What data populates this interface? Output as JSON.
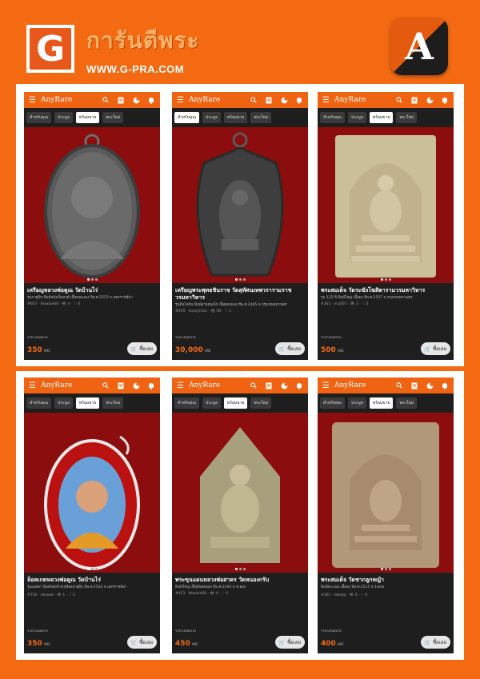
{
  "brand": {
    "logo_letter": "G",
    "title": "การันตีพระ",
    "url": "WWW.G-PRA.COM",
    "app_logo_letter": "A"
  },
  "app": {
    "name": "AnyRare",
    "tabs": [
      "สำหรับคุณ",
      "ประมูล",
      "พร้อมขาย",
      "พระใหม่"
    ],
    "price_label": "ราคาเสนอขาย",
    "price_unit": "ARC",
    "buy_label": "ซื้อเลย",
    "icons": [
      "menu-icon",
      "search-icon",
      "receipt-icon",
      "pie-chart-icon",
      "bell-icon"
    ],
    "accent": "#f06312"
  },
  "cards": [
    {
      "active_tab": 2,
      "title": "เหรียญหลวงพ่อคูณ วัดบ้านไร่",
      "sub": "รุ่นกาฐูลิข พิมพ์หลังเต็มองค์ เนื้อทองแดง ปีพ.ศ.2553 จ.นครราชสีมา",
      "id": "#667",
      "seller": "Newbie08",
      "views": "4",
      "likes": "0",
      "price": "350"
    },
    {
      "active_tab": 0,
      "title": "เหรียญพระพุทธชินราช วัดสุทัศนเทพวรารามราชวรมหาวิหาร",
      "sub": "รุ่นอินโดจีน พิมพ์สายฝนเล็ก เนื้อทองแดง ปีพ.ศ.2485 จ.กรุงเทพมหานคร",
      "id": "#295",
      "seller": "lovelyman",
      "views": "96",
      "likes": "1",
      "price": "30,000"
    },
    {
      "active_tab": 2,
      "title": "พระสมเด็จ วัดระฆังโฆสิตารามวรมหาวิหาร",
      "sub": "รุ่น 122 ปี พิมพ์ใหญ่ เนื้อผง ปีพ.ศ.2537 จ.กรุงเทพมหานคร",
      "id": "#361",
      "seller": "mu007",
      "views": "2",
      "likes": "0",
      "price": "500"
    },
    {
      "active_tab": 2,
      "title": "ล็อคเกตหลวงพ่อคูณ วัดบ้านไร่",
      "sub": "รุ่นเมตตา พิมพ์หลังจีวรเหลืองอายุยืน ปีพ.ศ.2534 จ.นครราชสีมา",
      "id": "#756",
      "seller": "ทองแอส",
      "views": "1",
      "likes": "0",
      "price": "350"
    },
    {
      "active_tab": 2,
      "title": "พระขุนแผนหลวงพ่อสาคร วัดหนองกรับ",
      "sub": "พิมพ์ใหญ่ เนื้อดินผสมผง ปีพ.ศ.2544 จ.ระยอง",
      "id": "#423",
      "seller": "Newbie08",
      "views": "4",
      "likes": "0",
      "price": "450"
    },
    {
      "active_tab": 2,
      "title": "พระสมเด็จ วัดชากลูกหญ้า",
      "sub": "พิมพ์คะแนน เนื้อผง ปีพ.ศ.2515 จ.ระยอง",
      "id": "#362",
      "seller": "ทองบุญ",
      "views": "6",
      "likes": "0",
      "price": "400"
    }
  ]
}
